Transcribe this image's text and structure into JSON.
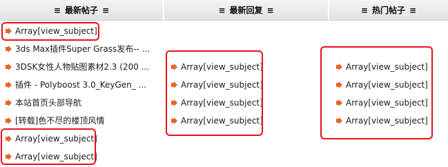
{
  "columns": {
    "latest_posts": {
      "title": "最新帖子",
      "deco": "≡"
    },
    "latest_replies": {
      "title": "最新回复",
      "deco": "≡"
    },
    "hot_posts": {
      "title": "热门帖子",
      "deco": "≡"
    }
  },
  "latest_posts": [
    "Array[view_subject]",
    "3ds Max插件Super Grass发布-- ...",
    "3DSK女性人物贴图素材2.3 (200 ...",
    "插件  - Polyboost 3.0_KeyGen_ ...",
    "本站首页头部导航",
    "[转载]色不尽的楼顶风情",
    "Array[view_subject]",
    "Array[view_subject]"
  ],
  "latest_replies": [
    "Array[view_subject]",
    "Array[view_subject]",
    "Array[view_subject]",
    "Array[view_subject]"
  ],
  "hot_posts": [
    "Array[view_subject]",
    "Array[view_subject]",
    "Array[view_subject]",
    "Array[view_subject]"
  ],
  "colors": {
    "bullet": "#e8652a",
    "highlight": "#e8101a",
    "header_bg": "#ececec"
  },
  "icons": {
    "bullet": "arrow-bullet-icon"
  }
}
